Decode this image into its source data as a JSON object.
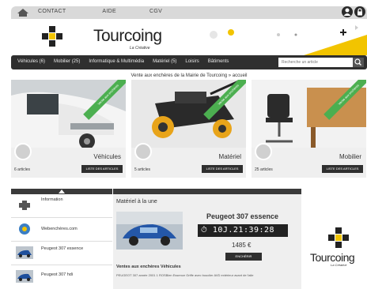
{
  "topbar": {
    "links": [
      "CONTACT",
      "AIDE",
      "CGV"
    ],
    "icons": [
      "user-icon",
      "lock-icon"
    ]
  },
  "header": {
    "brand": "Tourcoing",
    "tagline": "La Créative"
  },
  "nav": {
    "items": [
      "Véhicules (6)",
      "Mobilier (25)",
      "Informatique & Multimédia",
      "Matériel (5)",
      "Loisirs",
      "Bâtiments"
    ],
    "search_placeholder": "Recherche un article"
  },
  "subtitle": "Vente aux enchères de la Mairie de Tourcoing » accueil",
  "categories": [
    {
      "name": "Véhicules",
      "count": "6 articles",
      "button": "LISTE DES ARTICLES",
      "ribbon": "Vente aux enchères"
    },
    {
      "name": "Matériel",
      "count": "5 articles",
      "button": "LISTE DES ARTICLES",
      "ribbon": "Vente aux enchères"
    },
    {
      "name": "Mobilier",
      "count": "25 articles",
      "button": "LISTE DES ARTICLES",
      "ribbon": "Vente aux enchères"
    }
  ],
  "sidebar_list": [
    {
      "label": "Information"
    },
    {
      "label": "Webenchères.com"
    },
    {
      "label": "Peugeot 307 essence"
    },
    {
      "label": "Peugeot 307 hdi"
    }
  ],
  "feature": {
    "title": "Matériel à la une",
    "car_name": "Peugeot 307 essence",
    "countdown": "⏱ 10J.21:39:28",
    "price": "1485 €",
    "bid_button": "ENCHÉRIR",
    "subheading": "Ventes aux enchères Véhicules",
    "description": "PEUGEOT 307 année 2001 1 ROSBlen Essence Griffe avec bouclier AVD extérieur avant de l'aile"
  },
  "right_logo": {
    "brand": "Tourcoing",
    "tagline": "La Créative"
  },
  "colors": {
    "nav_bg": "#2f2f2f",
    "ribbon_green": "#4caf50",
    "card_bg": "#efefef"
  }
}
